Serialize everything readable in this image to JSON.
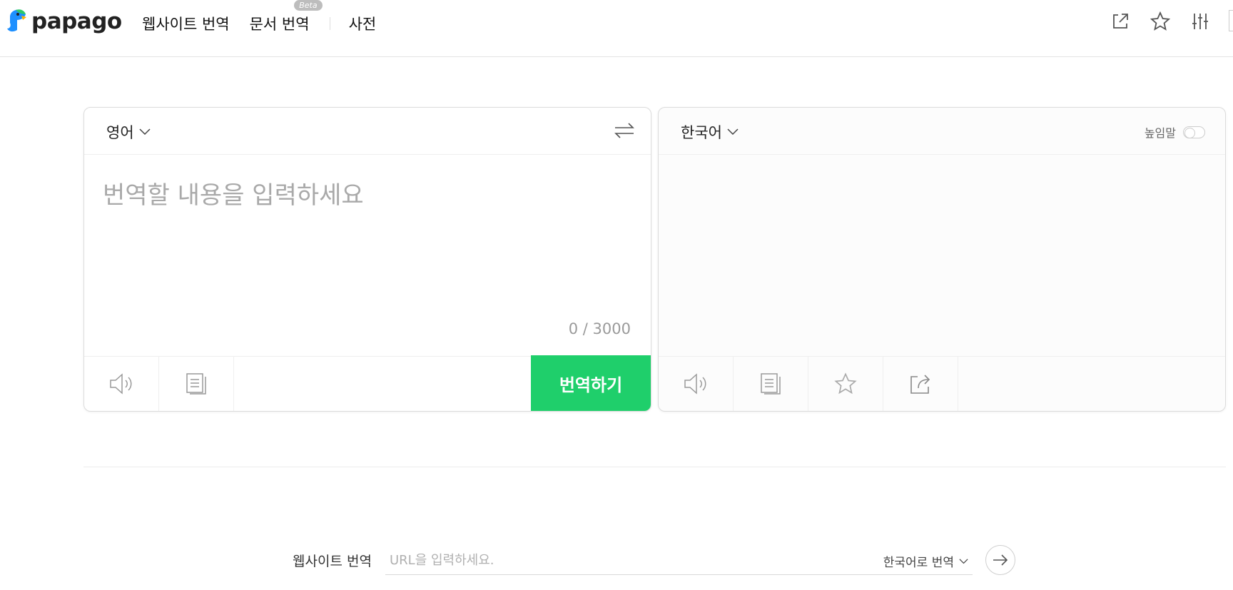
{
  "brand": {
    "name": "papago"
  },
  "nav": {
    "website_translate": "웹사이트 번역",
    "document_translate": "문서 번역",
    "document_badge": "Beta",
    "dictionary": "사전"
  },
  "header_icons": [
    "open-new-window-icon",
    "star-icon",
    "settings-sliders-icon"
  ],
  "source": {
    "language": "영어",
    "placeholder": "번역할 내용을 입력하세요",
    "value": "",
    "counter": "0 / 3000",
    "translate_button": "번역하기"
  },
  "target": {
    "language": "한국어",
    "honorific_label": "높임말",
    "honorific_on": false
  },
  "website": {
    "label": "웹사이트 번역",
    "url_placeholder": "URL을 입력하세요.",
    "target_language": "한국어로 번역"
  },
  "colors": {
    "accent": "#1fcf6b",
    "logo_blue": "#1e90ff",
    "logo_green": "#2ec96a"
  }
}
